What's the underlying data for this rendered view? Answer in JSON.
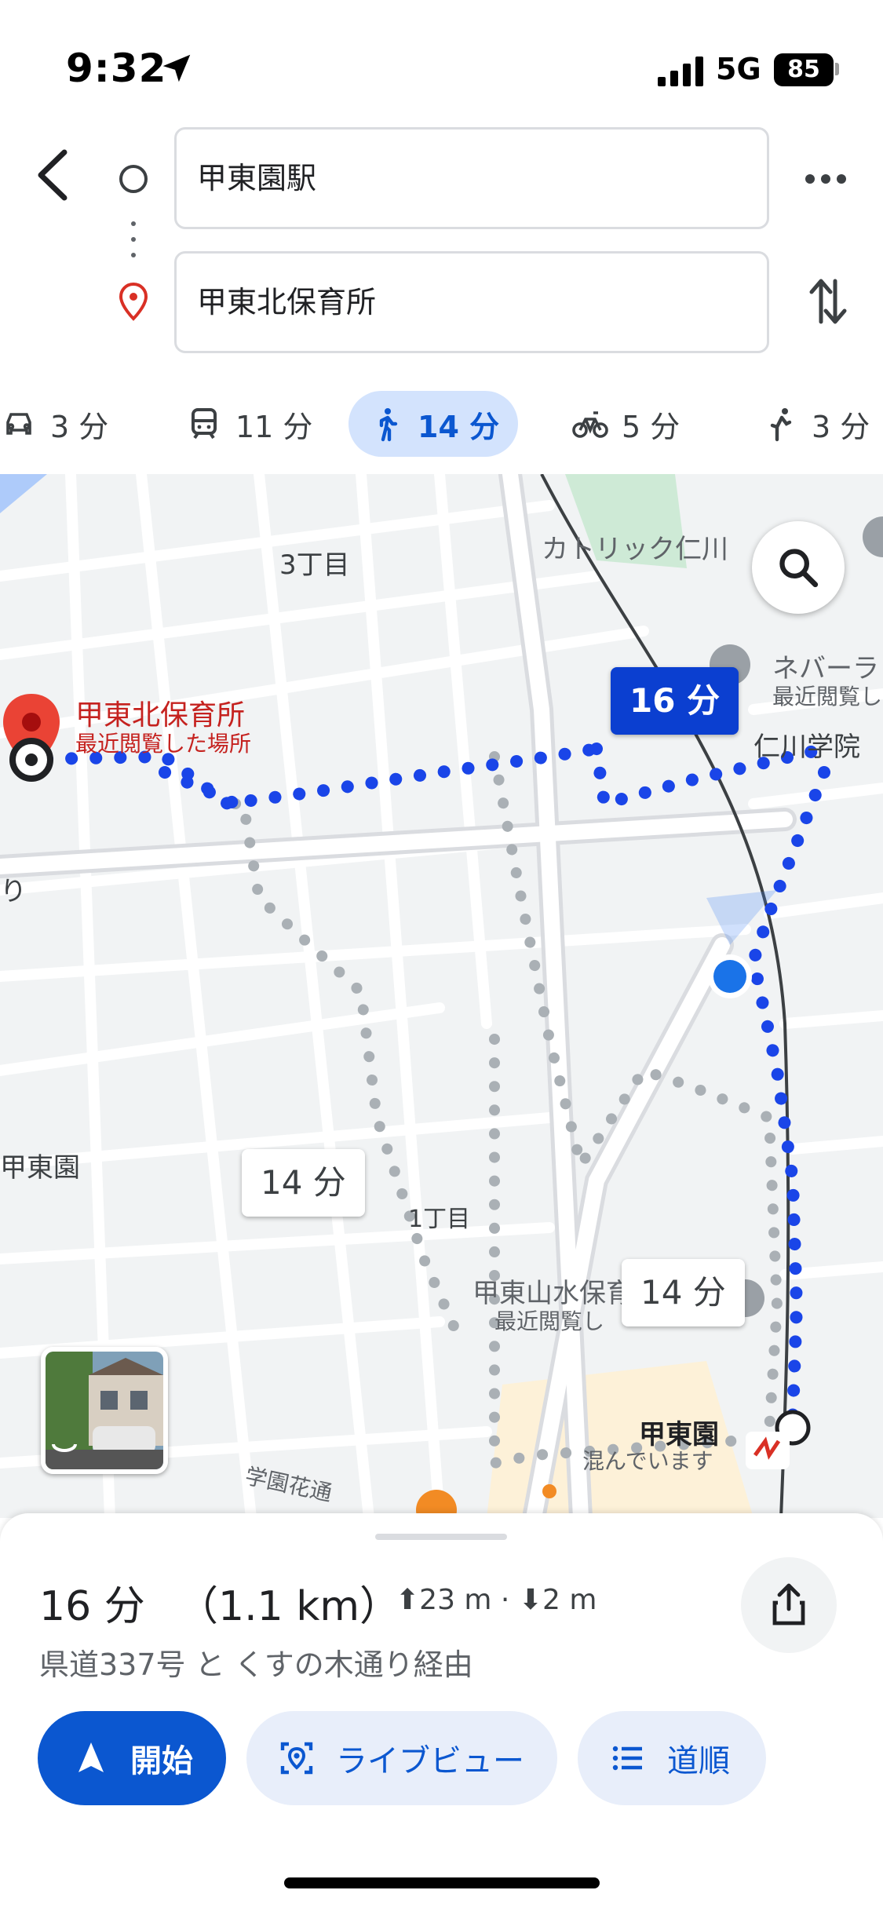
{
  "status_bar": {
    "time": "9:32",
    "network": "5G",
    "battery": "85"
  },
  "directions": {
    "origin": "甲東園駅",
    "destination": "甲東北保育所"
  },
  "modes": [
    {
      "icon": "car-icon",
      "label": "3 分"
    },
    {
      "icon": "train-icon",
      "label": "11 分"
    },
    {
      "icon": "walk-icon",
      "label": "14 分",
      "active": true
    },
    {
      "icon": "bike-icon",
      "label": "5 分"
    },
    {
      "icon": "ride-icon",
      "label": "3 分"
    }
  ],
  "map": {
    "destination_name": "甲東北保育所",
    "destination_sub": "最近閲覧した場所",
    "labels": {
      "area_3": "3丁目",
      "area_1": "1丁目",
      "church": "カトリック仁川",
      "nebar": "ネバーラ",
      "nebar_sub": "最近閲覧し",
      "school": "仁川学院",
      "kotoen": "甲東園",
      "nursery": "甲東山水保育園",
      "nursery_sub": "最近閲覧し",
      "station": "甲東園",
      "station_sub": "混んでいます",
      "street": "学園花通",
      "left_road": "り"
    },
    "bubbles": {
      "primary": "16 分",
      "alt1": "14 分",
      "alt2": "14 分"
    },
    "colors": {
      "route": "#1a45e8",
      "alt_route": "#aab0b5",
      "land": "#f1f3f4",
      "park": "#ceead6"
    }
  },
  "summary": {
    "eta": "16 分",
    "distance": "（1.1 km）",
    "elevation": "⬆23 m · ⬇2 m",
    "via": "県道337号 と くすの木通り経由"
  },
  "actions": {
    "start": "開始",
    "live_view": "ライブビュー",
    "steps": "道順"
  }
}
